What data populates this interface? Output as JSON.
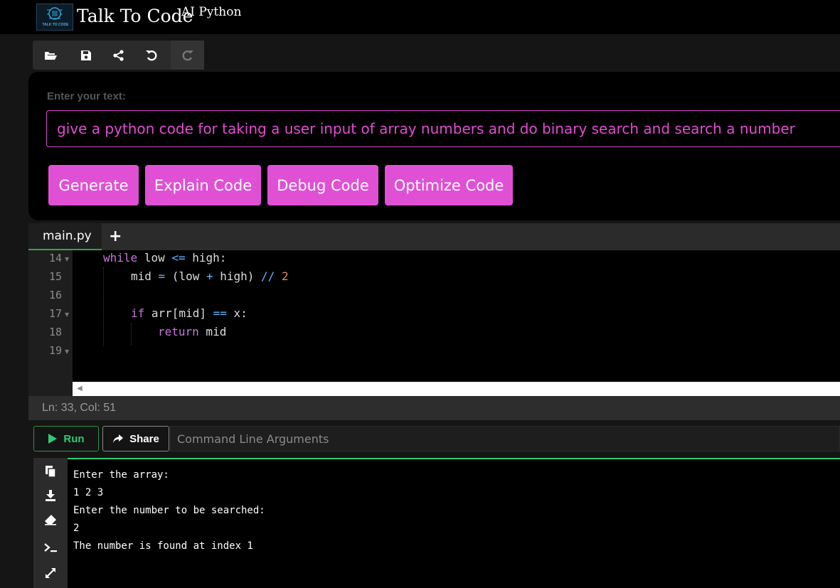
{
  "header": {
    "logo_text": "TALK TO CODE",
    "title": "Talk To Code",
    "subtitle": "AI Python"
  },
  "toolbar": {
    "icons": [
      "folder-open-icon",
      "save-icon",
      "share-icon",
      "undo-icon",
      "redo-icon"
    ]
  },
  "prompt": {
    "label": "Enter your text:",
    "value": "give a python code for taking a user input of array numbers and do binary search and search a number",
    "buttons": [
      "Generate",
      "Explain Code",
      "Debug Code",
      "Optimize Code"
    ]
  },
  "editor": {
    "tab": "main.py",
    "add_tab": "+",
    "line_numbers": [
      "14",
      "15",
      "16",
      "17",
      "18",
      "19"
    ],
    "status": "Ln: 33,  Col: 51"
  },
  "run_bar": {
    "run_label": "Run",
    "share_label": "Share",
    "args_placeholder": "Command Line Arguments"
  },
  "terminal": {
    "lines": [
      "Enter the array:",
      "1 2 3",
      "Enter the number to be searched:",
      "2",
      "The number is found at index 1"
    ],
    "icons": [
      "copy-icon",
      "download-icon",
      "eraser-icon",
      "terminal-icon",
      "expand-icon"
    ]
  },
  "colors": {
    "accent": "#e050d5",
    "run_green": "#2ecc71",
    "background": "#000000"
  }
}
